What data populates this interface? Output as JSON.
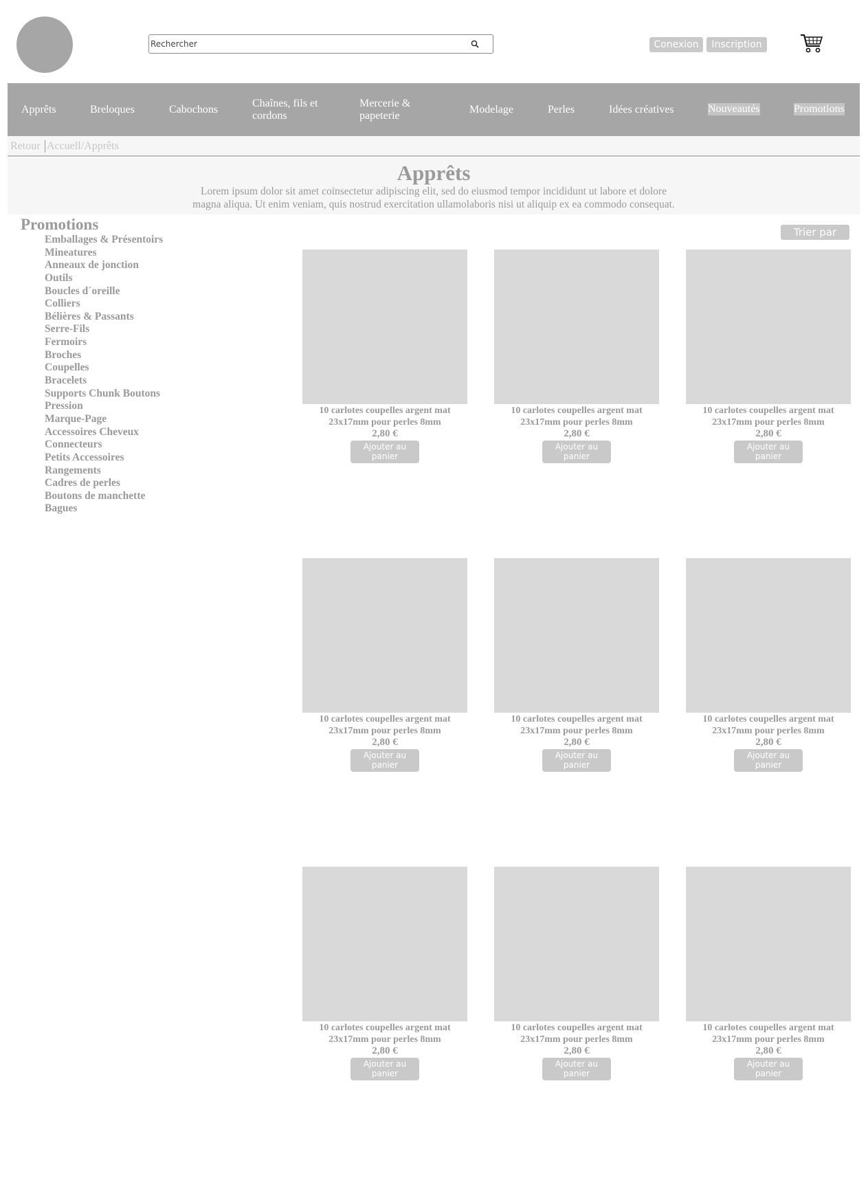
{
  "header": {
    "search_placeholder": "Rechercher",
    "login_label": "Conexion",
    "signup_label": "Inscription"
  },
  "nav": {
    "items": [
      {
        "label": "Apprêts"
      },
      {
        "label": "Breloques"
      },
      {
        "label": "Cabochons"
      },
      {
        "label": "Chaînes, fils et cordons"
      },
      {
        "label": "Mercerie & papeterie"
      },
      {
        "label": "Modelage"
      },
      {
        "label": "Perles"
      },
      {
        "label": "Idées créatives"
      },
      {
        "label": "Nouveautés"
      },
      {
        "label": "Promotions"
      }
    ]
  },
  "breadcrumb": {
    "back": "Retour",
    "path": "Accuell/Apprêts"
  },
  "hero": {
    "title": "Apprêts",
    "line1": "Lorem ipsum dolor sit amet coinsectetur adipiscing elit, sed do eiusmod tempor incididunt ut labore et dolore",
    "line2": "magna aliqua. Ut enim veniam, quis nostrud exercitation ullamolaboris nisi ut aliquip ex ea commodo consequat."
  },
  "sidebar": {
    "title": "Promotions",
    "items": [
      "Emballages & Présentoirs",
      "Mineatures",
      "Anneaux de jonction",
      "Outils",
      "Boucles d´oreille",
      "Colliers",
      "Bélières & Passants",
      "Serre-Fils",
      "Fermoirs",
      "Broches",
      "Coupelles",
      "Bracelets",
      "Supports Chunk Boutons",
      "Pression",
      "Marque-Page",
      "Accessoires Cheveux",
      "Connecteurs",
      "Petits Accessoires",
      "Rangements",
      "Cadres de perles",
      "Boutons de manchette",
      "Bagues"
    ]
  },
  "sort_label": "Trier par",
  "products": [
    {
      "title": "10 carlotes coupelles argent mat 23x17mm pour perles 8mm",
      "price": "2,80 €",
      "button": "Ajouter au panier"
    },
    {
      "title": "10 carlotes coupelles argent mat 23x17mm pour perles 8mm",
      "price": "2,80 €",
      "button": "Ajouter au panier"
    },
    {
      "title": "10 carlotes coupelles argent mat 23x17mm pour perles 8mm",
      "price": "2,80 €",
      "button": "Ajouter au panier"
    },
    {
      "title": "10 carlotes coupelles argent mat 23x17mm pour perles 8mm",
      "price": "2,80 €",
      "button": "Ajouter au panier"
    },
    {
      "title": "10 carlotes coupelles argent mat 23x17mm pour perles 8mm",
      "price": "2,80 €",
      "button": "Ajouter au panier"
    },
    {
      "title": "10 carlotes coupelles argent mat 23x17mm pour perles 8mm",
      "price": "2,80 €",
      "button": "Ajouter au panier"
    },
    {
      "title": "10 carlotes coupelles argent mat 23x17mm pour perles 8mm",
      "price": "2,80 €",
      "button": "Ajouter au panier"
    },
    {
      "title": "10 carlotes coupelles argent mat 23x17mm pour perles 8mm",
      "price": "2,80 €",
      "button": "Ajouter au panier"
    },
    {
      "title": "10 carlotes coupelles argent mat 23x17mm pour perles 8mm",
      "price": "2,80 €",
      "button": "Ajouter au panier"
    }
  ],
  "icons": {
    "search": "search-icon",
    "cart": "cart-icon",
    "logo": "logo"
  },
  "colors": {
    "nav_bg": "#a6a6a6",
    "highlight": "#c4c4c4",
    "placeholder_image": "#d9d9d9",
    "button_bg": "#c9c9c9",
    "text": "#9a9a9a"
  }
}
